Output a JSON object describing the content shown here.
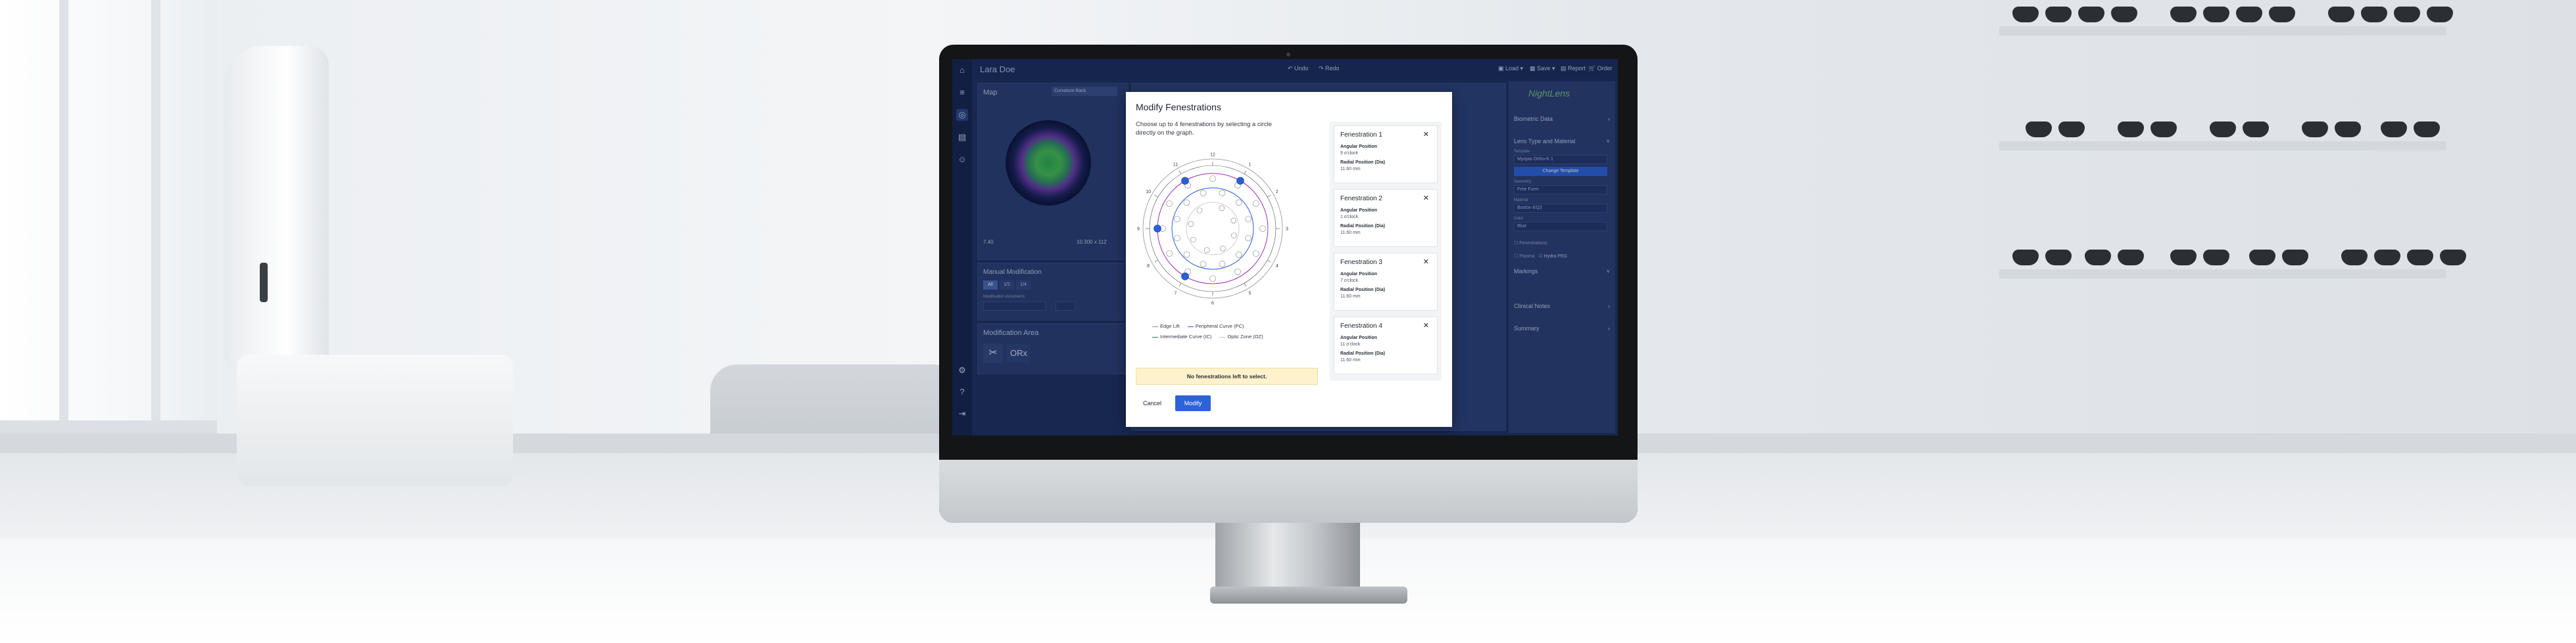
{
  "app": {
    "patient_name": "Lara Doe",
    "undo_label": "Undo",
    "redo_label": "Redo",
    "load_label": "Load",
    "save_label": "Save",
    "report_label": "Report",
    "order_label": "Order"
  },
  "left_panel": {
    "map_title": "Map",
    "map_dropdown": "Curvature Back",
    "map_left_value": "7.40",
    "map_right_value": "10.300 x 112",
    "manual_modification_title": "Manual Modification",
    "mod_tabs": [
      "All",
      "1/2",
      "1/4"
    ],
    "modification_increments_label": "Modification increments",
    "modification_area_title": "Modification Area"
  },
  "right_panel": {
    "logo_text": "NightLens",
    "biometric_data": "Biometric Data",
    "lens_type_material": "Lens Type and Material",
    "template_label": "Template",
    "template_value": "Myopia Ortho-K 1",
    "change_template": "Change Template",
    "geometry_label": "Geometry",
    "geometry_value": "Free Form",
    "material_label": "Material",
    "material_value": "Boston EQ2",
    "color_label": "Color",
    "color_value": "Blue",
    "fenestrations_label": "Fenestrations",
    "plasma_label": "Plasma",
    "hydra_peg_label": "Hydra PEG",
    "markings": "Markings",
    "clinical_notes": "Clinical Notes",
    "summary": "Summary"
  },
  "modal": {
    "title": "Modify Fenestrations",
    "description": "Choose up to 4 fenestrations by selecting a circle directly on the graph.",
    "legend": {
      "edge_lift": "Edge Lift",
      "peripheral_curve": "Peripheral Curve (PC)",
      "intermediate_curve": "Intermediate Curve (IC)",
      "optic_zone": "Optic Zone (OZ)"
    },
    "clock_labels": [
      "12",
      "1",
      "2",
      "3",
      "4",
      "5",
      "6",
      "7",
      "8",
      "9",
      "10",
      "11"
    ],
    "notice": "No fenestrations left to select.",
    "cancel_label": "Cancel",
    "modify_label": "Modify",
    "angular_position_label": "Angular Position",
    "radial_position_label": "Radial Position (Dia)",
    "fenestrations": [
      {
        "name": "Fenestration 1",
        "angular": "9 o'clock",
        "radial": "11.60 mm"
      },
      {
        "name": "Fenestration 2",
        "angular": "1 o'clock",
        "radial": "11.60 mm"
      },
      {
        "name": "Fenestration 3",
        "angular": "7 o'clock",
        "radial": "11.60 mm"
      },
      {
        "name": "Fenestration 4",
        "angular": "11 o'clock",
        "radial": "11.60 mm"
      }
    ]
  },
  "colors": {
    "accent": "#2d63d8",
    "app_bg": "#1e2f5c",
    "notice_bg": "#fdf2cc",
    "edge_lift": "#8a8f99",
    "peripheral_curve": "#9b2fb5",
    "intermediate_curve": "#2a5fd6",
    "optic_zone": "#bfc3ca"
  }
}
